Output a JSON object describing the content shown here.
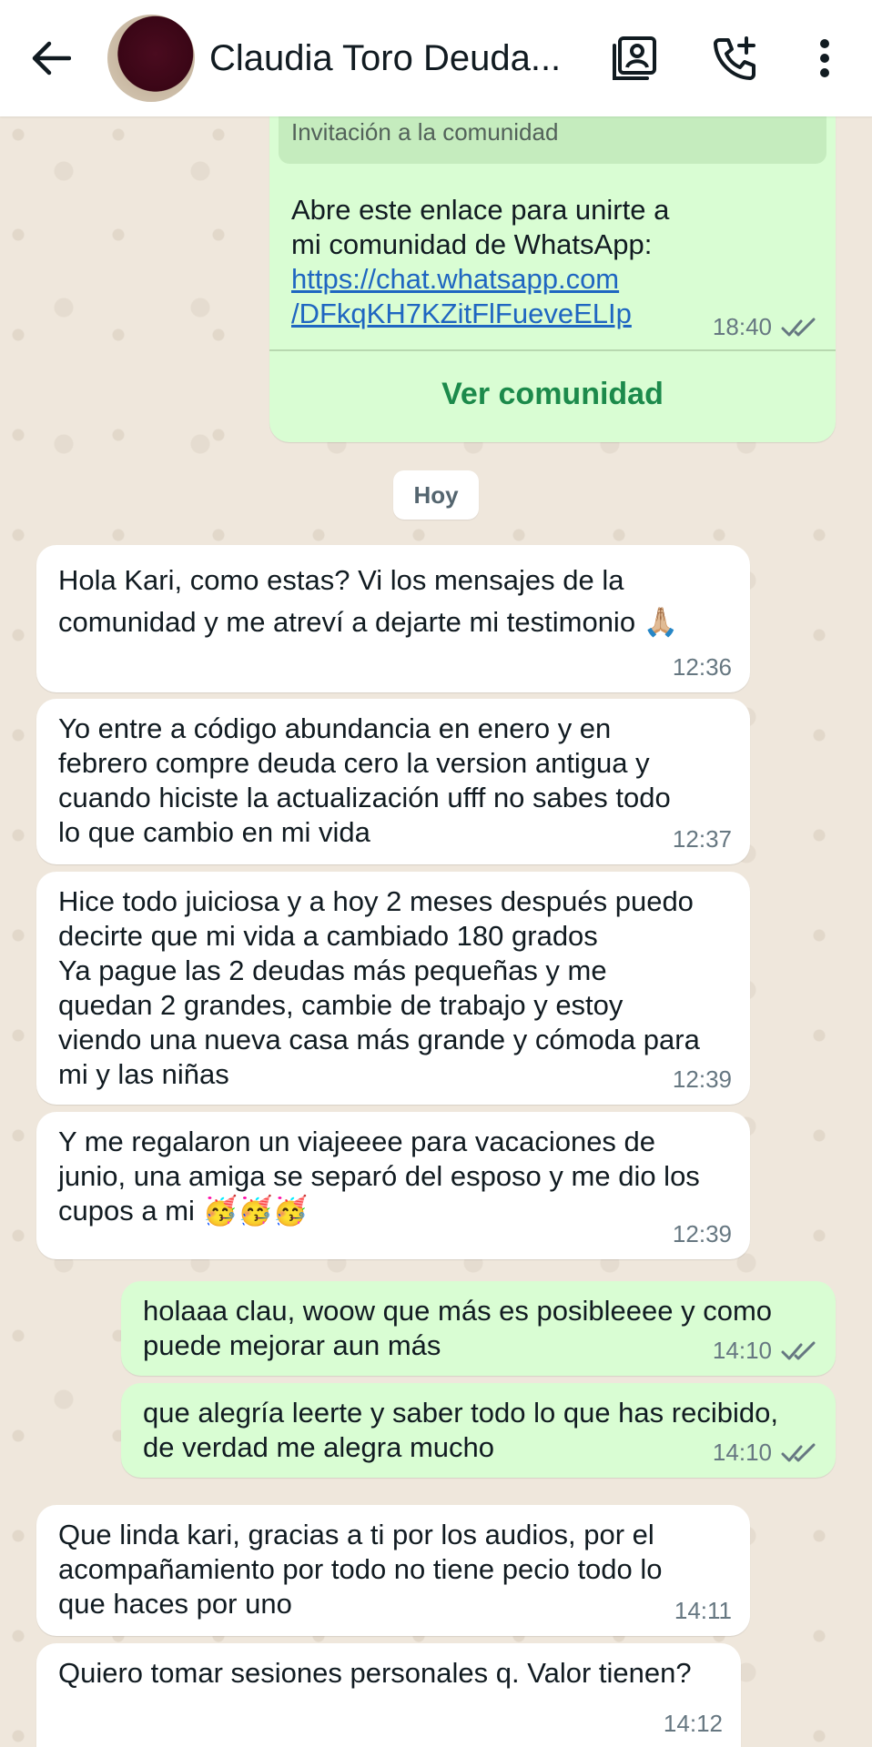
{
  "header": {
    "contact_name": "Claudia Toro Deuda..."
  },
  "invite_card": {
    "label": "Invitación a la comunidad",
    "text_line1": "Abre este enlace para unirte a",
    "text_line2": "mi comunidad de WhatsApp:",
    "link_line1": "https://chat.whatsapp.com",
    "link_line2": "/DFkqKH7KZitFlFueveELIp",
    "time": "18:40",
    "button_label": "Ver comunidad"
  },
  "date_chip": "Hoy",
  "messages": [
    {
      "direction": "in",
      "text": "Hola Kari, como estas? Vi los mensajes de la\ncomunidad y me atreví a dejarte mi testimonio 🙏🏼",
      "time": "12:36"
    },
    {
      "direction": "in",
      "text": "Yo entre a código abundancia en enero y en\nfebrero compre deuda cero la version antigua y\ncuando hiciste la actualización ufff no sabes todo\nlo que cambio en mi vida",
      "time": "12:37"
    },
    {
      "direction": "in",
      "text": "Hice todo juiciosa y a hoy 2 meses después puedo\ndecirte que mi vida a cambiado 180 grados\nYa pague las 2 deudas más pequeñas y me\nquedan 2 grandes, cambie de trabajo y estoy\nviendo una nueva casa más grande y cómoda para\nmi y las niñas",
      "time": "12:39"
    },
    {
      "direction": "in",
      "text": "Y me regalaron un viajeeee para vacaciones de\njunio, una amiga se separó del esposo y me dio los\ncupos a mi 🥳🥳🥳",
      "time": "12:39"
    },
    {
      "direction": "out",
      "text": "holaaa clau, woow que más es posibleeee y como\npuede mejorar aun más",
      "time": "14:10"
    },
    {
      "direction": "out",
      "text": "que alegría leerte y saber todo lo que has recibido,\nde verdad me alegra mucho",
      "time": "14:10"
    },
    {
      "direction": "in",
      "text": "Que linda kari, gracias a ti por los audios, por el\nacompañamiento por todo no tiene pecio todo lo\nque haces por uno",
      "time": "14:11"
    },
    {
      "direction": "in",
      "text": "Quiero tomar sesiones personales q. Valor tienen?",
      "time": "14:12"
    }
  ]
}
